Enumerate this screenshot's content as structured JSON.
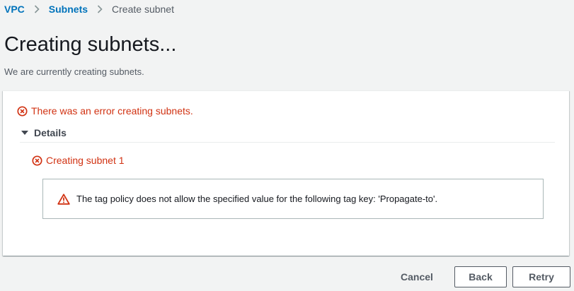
{
  "breadcrumb": {
    "items": [
      "VPC",
      "Subnets"
    ],
    "current": "Create subnet"
  },
  "page": {
    "title": "Creating subnets...",
    "description": "We are currently creating subnets."
  },
  "status": {
    "error_message": "There was an error creating subnets.",
    "details_label": "Details",
    "subnet_error": "Creating subnet 1",
    "alert_text": "The tag policy does not allow the specified value for the following tag key: 'Propagate-to'."
  },
  "footer": {
    "cancel_label": "Cancel",
    "back_label": "Back",
    "retry_label": "Retry"
  },
  "colors": {
    "link": "#0073bb",
    "error": "#d13212",
    "background": "#f2f3f3"
  },
  "icons": {
    "breadcrumb_separator": "chevron-right-icon",
    "error": "error-circle-x-icon",
    "details_toggle": "caret-down-icon",
    "alert": "warning-triangle-icon"
  }
}
